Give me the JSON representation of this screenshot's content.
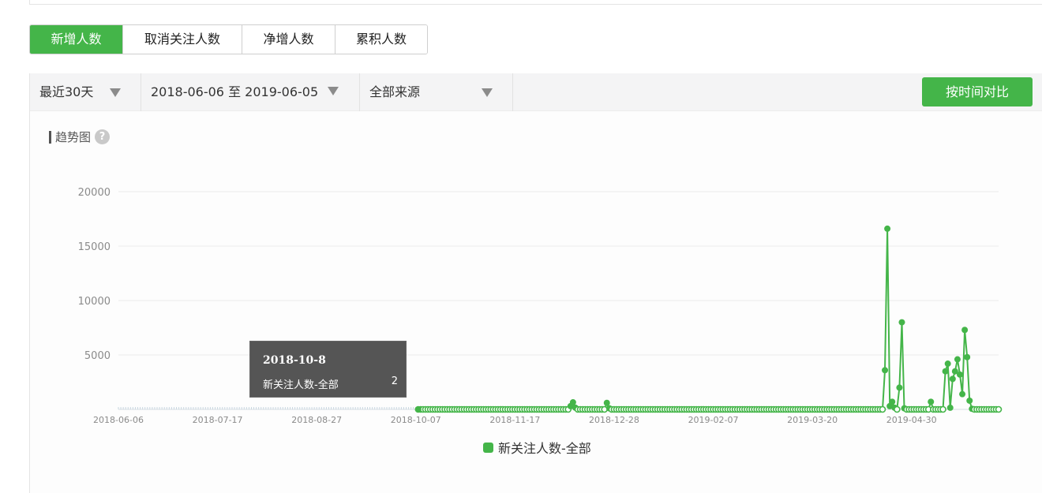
{
  "tabs": [
    {
      "label": "新增人数",
      "active": true
    },
    {
      "label": "取消关注人数",
      "active": false
    },
    {
      "label": "净增人数",
      "active": false
    },
    {
      "label": "累积人数",
      "active": false
    }
  ],
  "filters": {
    "period": "最近30天",
    "date_range": "2018-06-06 至 2019-06-05",
    "source": "全部来源"
  },
  "compare_button": "按时间对比",
  "trend": {
    "title": "趋势图",
    "help_icon": "question-mark-icon"
  },
  "tooltip": {
    "date": "2018-10-8",
    "label": "新关注人数-全部",
    "value": "2"
  },
  "colors": {
    "accent": "#44b549",
    "tooltip_bg": "#555555",
    "axis_text": "#8a8a8a"
  },
  "chart_data": {
    "type": "line",
    "y_ticks": [
      "20000",
      "15000",
      "10000",
      "5000"
    ],
    "ylim": [
      0,
      20000
    ],
    "x_tick_labels": [
      "2018-06-06",
      "2018-07-17",
      "2018-08-27",
      "2018-10-07",
      "2018-11-17",
      "2018-12-28",
      "2019-02-07",
      "2019-03-20",
      "2019-04-30"
    ],
    "x_start": "2018-06-06",
    "x_end": "2019-06-05",
    "grid": true,
    "legend": "bottom",
    "series": [
      {
        "name": "新关注人数-全部",
        "data_start": "2018-10-08",
        "baseline_value": 0,
        "points": [
          {
            "date": "2018-12-10",
            "value": 300
          },
          {
            "date": "2018-12-11",
            "value": 650
          },
          {
            "date": "2018-12-12",
            "value": 150
          },
          {
            "date": "2018-12-25",
            "value": 600
          },
          {
            "date": "2018-12-26",
            "value": 100
          },
          {
            "date": "2019-04-19",
            "value": 3600
          },
          {
            "date": "2019-04-20",
            "value": 16600
          },
          {
            "date": "2019-04-21",
            "value": 300
          },
          {
            "date": "2019-04-22",
            "value": 700
          },
          {
            "date": "2019-04-23",
            "value": 150
          },
          {
            "date": "2019-04-25",
            "value": 2000
          },
          {
            "date": "2019-04-26",
            "value": 8000
          },
          {
            "date": "2019-04-27",
            "value": 100
          },
          {
            "date": "2019-05-08",
            "value": 700
          },
          {
            "date": "2019-05-14",
            "value": 3500
          },
          {
            "date": "2019-05-15",
            "value": 4200
          },
          {
            "date": "2019-05-16",
            "value": 150
          },
          {
            "date": "2019-05-17",
            "value": 2800
          },
          {
            "date": "2019-05-18",
            "value": 3500
          },
          {
            "date": "2019-05-19",
            "value": 4600
          },
          {
            "date": "2019-05-20",
            "value": 3200
          },
          {
            "date": "2019-05-21",
            "value": 1400
          },
          {
            "date": "2019-05-22",
            "value": 7300
          },
          {
            "date": "2019-05-23",
            "value": 4800
          },
          {
            "date": "2019-05-24",
            "value": 800
          },
          {
            "date": "2019-05-25",
            "value": 50
          }
        ]
      }
    ]
  }
}
